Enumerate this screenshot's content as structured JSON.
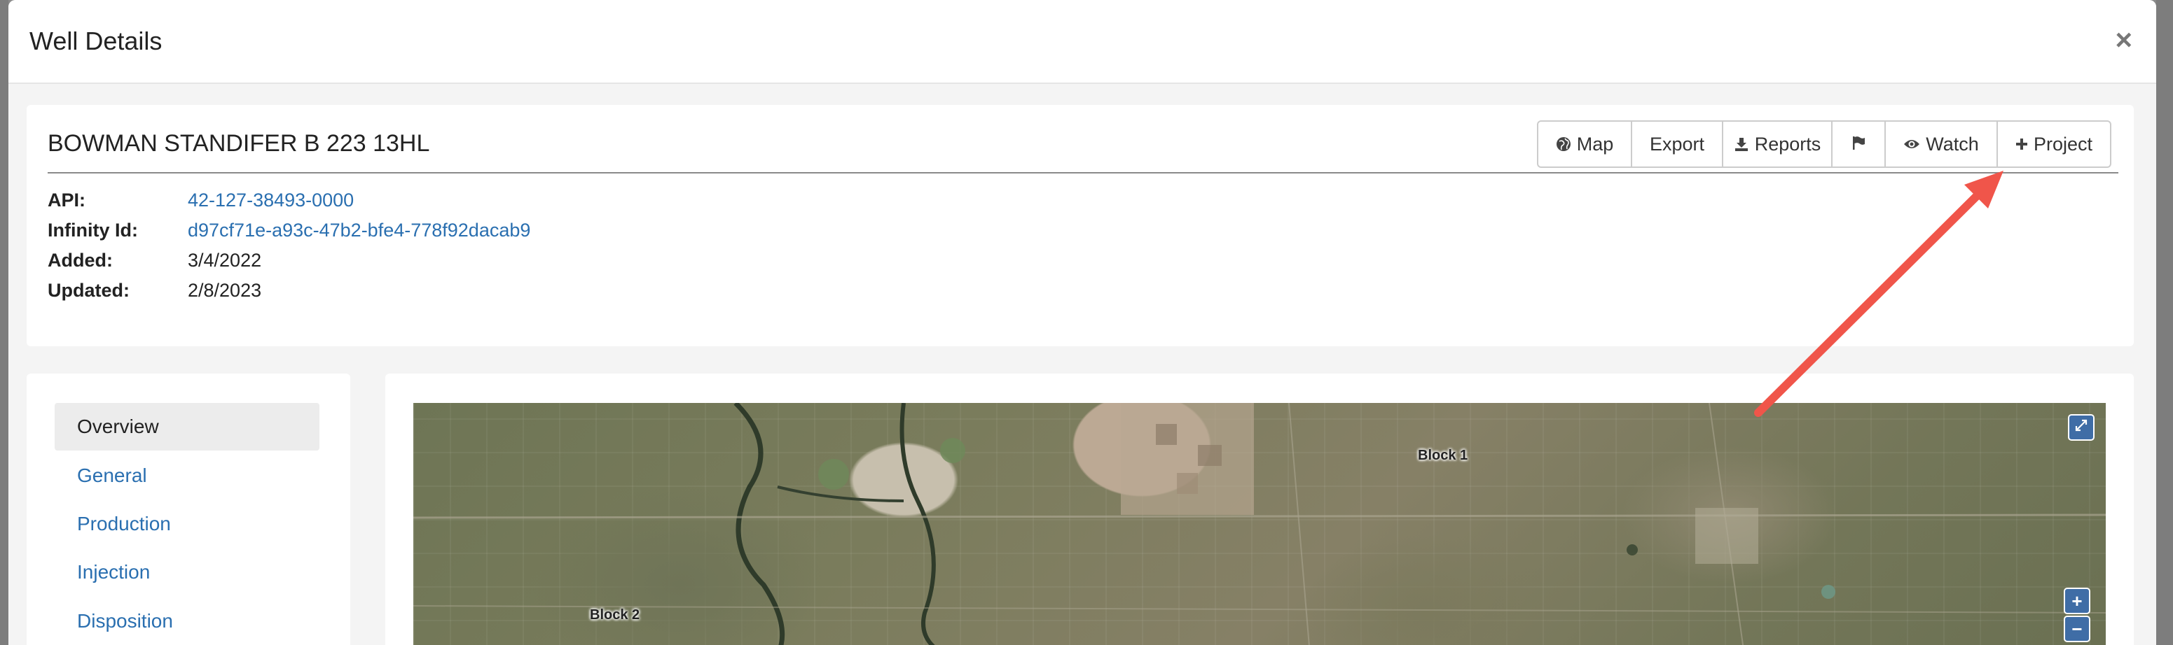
{
  "modal": {
    "title": "Well Details",
    "close_label": "×"
  },
  "well": {
    "name": "BOWMAN STANDIFER B 223 13HL",
    "fields": [
      {
        "label": "API:",
        "value": "42-127-38493-0000",
        "link": true
      },
      {
        "label": "Infinity Id:",
        "value": "d97cf71e-a93c-47b2-bfe4-778f92dacab9",
        "link": true
      },
      {
        "label": "Added:",
        "value": "3/4/2022",
        "link": false
      },
      {
        "label": "Updated:",
        "value": "2/8/2023",
        "link": false
      }
    ]
  },
  "toolbar": {
    "map_label": "Map",
    "export_label": "Export",
    "reports_label": "Reports",
    "watch_label": "Watch",
    "project_label": "Project",
    "map_icon": "globe-icon",
    "reports_icon": "download-icon",
    "flag_icon": "flag-icon",
    "watch_icon": "eye-icon",
    "project_icon": "plus-icon"
  },
  "sidebar": {
    "items": [
      {
        "label": "Overview",
        "active": true
      },
      {
        "label": "General",
        "active": false
      },
      {
        "label": "Production",
        "active": false
      },
      {
        "label": "Injection",
        "active": false
      },
      {
        "label": "Disposition",
        "active": false
      }
    ]
  },
  "map": {
    "labels": [
      "Block 1",
      "Block 2"
    ],
    "fullscreen_icon": "expand-icon",
    "zoom_in_label": "+",
    "zoom_out_label": "−"
  },
  "annotation": {
    "arrow_color": "#f0554a",
    "points_to": "project-button"
  },
  "colors": {
    "link": "#2a6fb0",
    "active_nav_bg": "#ececec",
    "map_control": "#3f6da6"
  }
}
